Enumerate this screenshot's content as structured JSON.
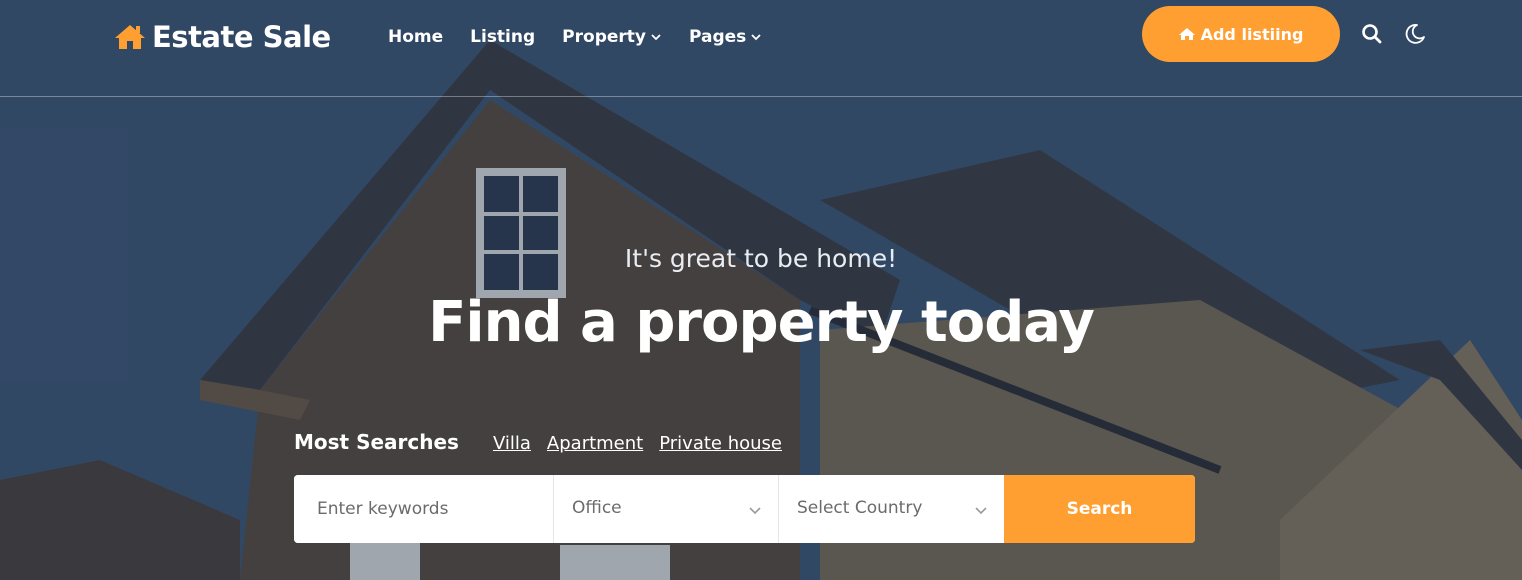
{
  "brand": {
    "name": "Estate Sale",
    "accent": "#ff9f32"
  },
  "nav": {
    "items": [
      {
        "label": "Home",
        "has_dropdown": false
      },
      {
        "label": "Listing",
        "has_dropdown": false
      },
      {
        "label": "Property",
        "has_dropdown": true
      },
      {
        "label": "Pages",
        "has_dropdown": true
      }
    ]
  },
  "header": {
    "add_listing_label": "Add listiing",
    "icons": [
      "home-icon",
      "search-icon",
      "moon-icon"
    ]
  },
  "hero": {
    "tagline": "It's great to be home!",
    "headline": "Find a property today"
  },
  "most_searches": {
    "label": "Most Searches",
    "links": [
      "Villa",
      "Apartment",
      "Private house"
    ]
  },
  "search": {
    "keywords_placeholder": "Enter keywords",
    "type_value": "Office",
    "country_value": "Select Country",
    "button_label": "Search"
  }
}
